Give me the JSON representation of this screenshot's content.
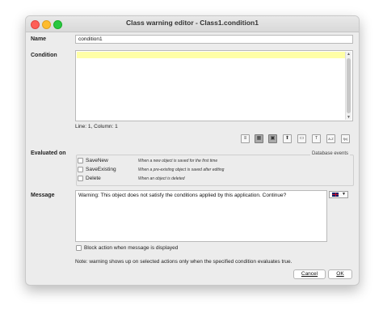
{
  "window": {
    "title": "Class warning editor - Class1.condition1"
  },
  "name": {
    "label": "Name",
    "value": "condition1"
  },
  "condition": {
    "label": "Condition",
    "value": "",
    "status": "Line: 1, Column: 1"
  },
  "toolbar": {
    "icons": [
      "list-view-icon",
      "grid-icon",
      "grid-alt-icon",
      "upload-icon",
      "monitor-icon",
      "text-format-icon",
      "sort-icon",
      "function-icon"
    ],
    "sort_label": "A-Z",
    "func_label": "f(x)"
  },
  "evaluated": {
    "label": "Evaluated on",
    "group_title": "Database events",
    "events": [
      {
        "name": "SaveNew",
        "description": "When a new object is saved for the first time",
        "checked": false
      },
      {
        "name": "SaveExisting",
        "description": "When a pre-existing object is saved after editing",
        "checked": false
      },
      {
        "name": "Delete",
        "description": "When an object is deleted",
        "checked": false
      }
    ]
  },
  "message": {
    "label": "Message",
    "value": "Warning: This object does not satisfy the conditions applied by this application. Continue?",
    "language_icon": "uk-flag-icon"
  },
  "block": {
    "label": "Block action when message is displayed",
    "checked": false
  },
  "note": "Note: warning shows up on selected actions only when the specified condition evaluates true.",
  "buttons": {
    "cancel": "Cancel",
    "ok": "OK"
  }
}
